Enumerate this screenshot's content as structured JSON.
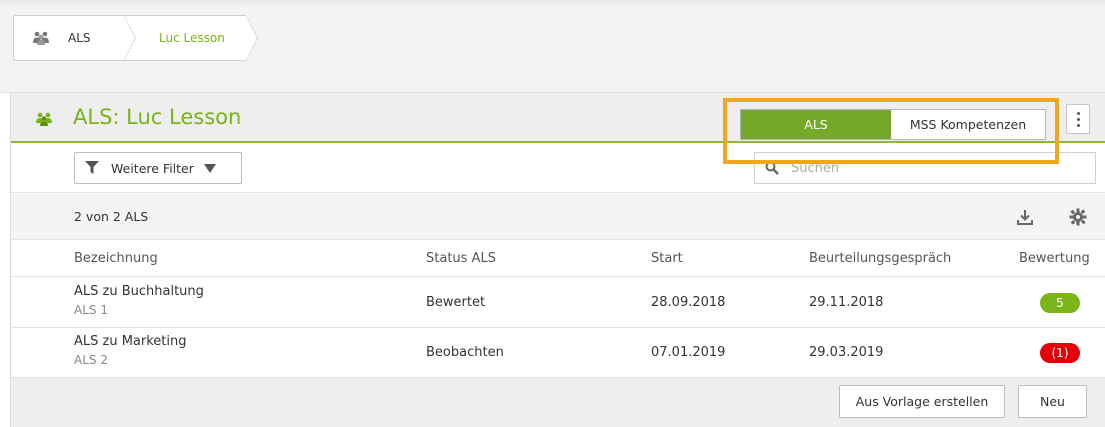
{
  "breadcrumb": {
    "items": [
      {
        "label": "ALS",
        "icon": "group-icon"
      },
      {
        "label": "Luc Lesson"
      }
    ]
  },
  "panel": {
    "title": "ALS: Luc Lesson",
    "title_icon": "group-icon",
    "accent_color": "#7ab317"
  },
  "toggle": {
    "options": [
      "ALS",
      "MSS Kompetenzen"
    ],
    "selected": "ALS"
  },
  "filter": {
    "label": "Weitere Filter"
  },
  "search": {
    "placeholder": "Suchen"
  },
  "list": {
    "count_text": "2 von 2 ALS",
    "columns": [
      "Bezeichnung",
      "Status ALS",
      "Start",
      "Beurteilungsgespräch",
      "Bewertung"
    ],
    "rows": [
      {
        "name": "ALS zu Buchhaltung",
        "sub": "ALS 1",
        "status": "Bewertet",
        "start": "28.09.2018",
        "review": "29.11.2018",
        "rating": "5",
        "rating_color": "#7cb51a"
      },
      {
        "name": "ALS zu Marketing",
        "sub": "ALS 2",
        "status": "Beobachten",
        "start": "07.01.2019",
        "review": "29.03.2019",
        "rating": "(1)",
        "rating_color": "#e3000b"
      }
    ]
  },
  "footer": {
    "template_button": "Aus Vorlage erstellen",
    "new_button": "Neu"
  },
  "highlight_color": "#f0a71f"
}
